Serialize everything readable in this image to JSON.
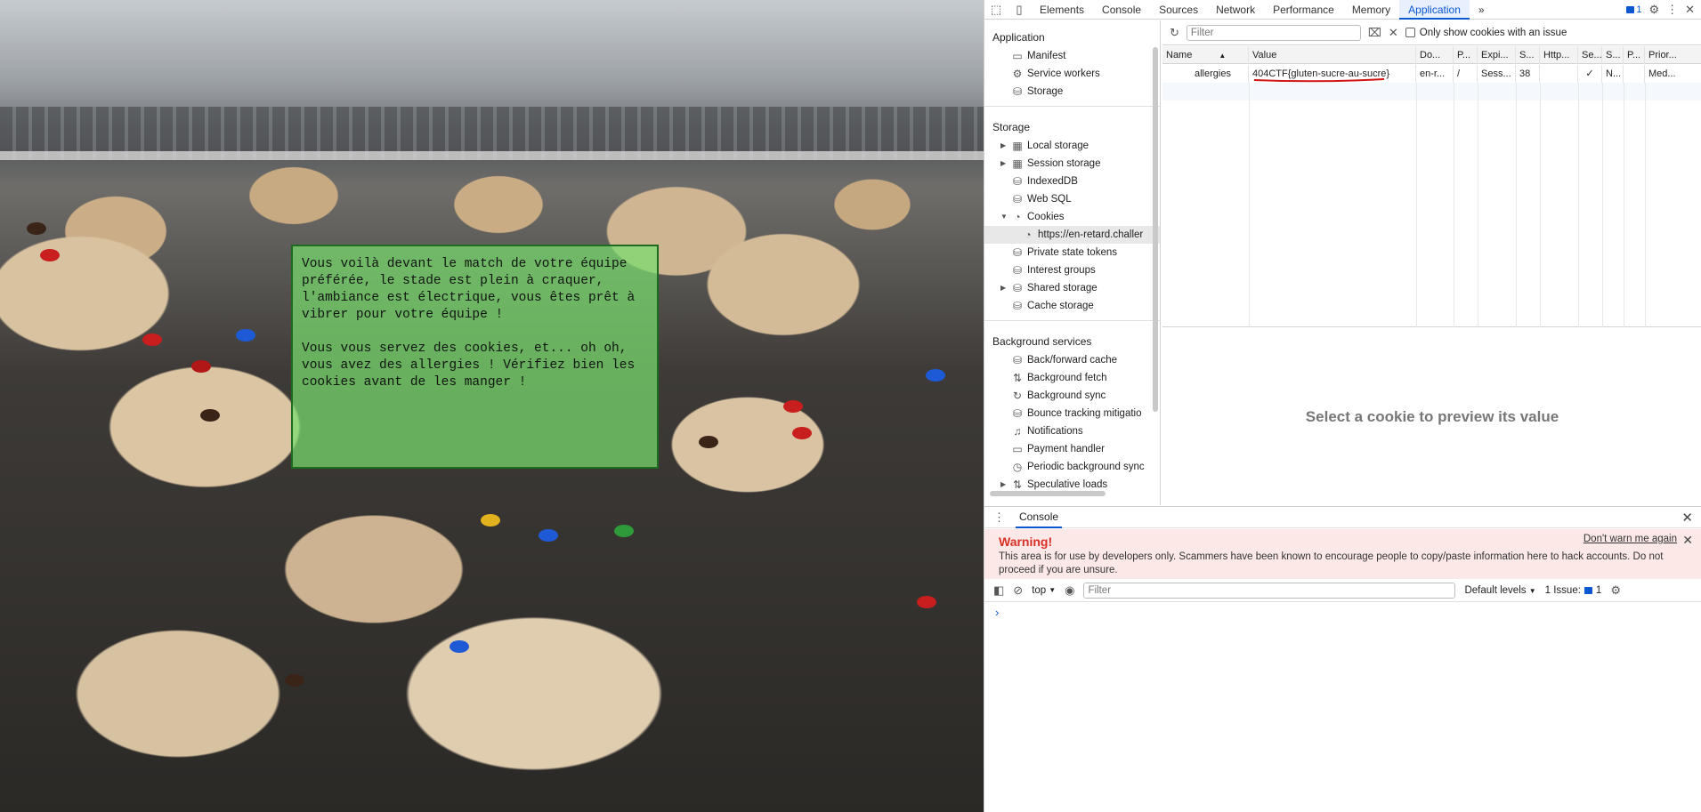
{
  "webpage": {
    "story": [
      "Vous voilà devant le match de votre équipe\npréférée, le stade est plein à craquer,\nl'ambiance est électrique, vous êtes prêt à\nvibrer pour votre équipe !",
      "Vous vous servez des cookies, et... oh oh,\nvous avez des allergies ! Vérifiez bien les\ncookies avant de les manger !"
    ]
  },
  "devtools": {
    "tabs": [
      "Elements",
      "Console",
      "Sources",
      "Network",
      "Performance",
      "Memory",
      "Application"
    ],
    "active_tab": "Application",
    "more_tabs": "»",
    "issues_count": "1",
    "sidebar": {
      "application_header": "Application",
      "application_items": [
        {
          "label": "Manifest",
          "icon": "document-icon"
        },
        {
          "label": "Service workers",
          "icon": "gear-icon"
        },
        {
          "label": "Storage",
          "icon": "database-icon"
        }
      ],
      "storage_header": "Storage",
      "storage_items": [
        {
          "label": "Local storage",
          "icon": "grid-icon"
        },
        {
          "label": "Session storage",
          "icon": "grid-icon"
        },
        {
          "label": "IndexedDB",
          "icon": "database-icon"
        },
        {
          "label": "Web SQL",
          "icon": "database-icon"
        },
        {
          "label": "Cookies",
          "icon": "cookie-icon"
        },
        {
          "label": "https://en-retard.challer",
          "icon": "cookie-icon"
        },
        {
          "label": "Private state tokens",
          "icon": "database-icon"
        },
        {
          "label": "Interest groups",
          "icon": "database-icon"
        },
        {
          "label": "Shared storage",
          "icon": "database-icon"
        },
        {
          "label": "Cache storage",
          "icon": "database-icon"
        }
      ],
      "background_header": "Background services",
      "background_items": [
        {
          "label": "Back/forward cache",
          "icon": "database-icon"
        },
        {
          "label": "Background fetch",
          "icon": "swap-icon"
        },
        {
          "label": "Background sync",
          "icon": "sync-icon"
        },
        {
          "label": "Bounce tracking mitigatio",
          "icon": "database-icon"
        },
        {
          "label": "Notifications",
          "icon": "bell-icon"
        },
        {
          "label": "Payment handler",
          "icon": "card-icon"
        },
        {
          "label": "Periodic background sync",
          "icon": "clock-icon"
        },
        {
          "label": "Speculative loads",
          "icon": "swap-icon"
        }
      ]
    },
    "toolbar": {
      "filter_placeholder": "Filter",
      "only_issues_label": "Only show cookies with an issue"
    },
    "cookie_table": {
      "headers": [
        "Name",
        "Value",
        "Do...",
        "P...",
        "Expi...",
        "S...",
        "Http...",
        "Se...",
        "S...",
        "P...",
        "Prior..."
      ],
      "rows": [
        [
          "allergies",
          "404CTF{gluten-sucre-au-sucre}",
          "en-r...",
          "/",
          "Sess...",
          "38",
          "",
          "✓",
          "N...",
          "",
          "Med..."
        ]
      ]
    },
    "preview_message": "Select a cookie to preview its value",
    "console": {
      "tab_label": "Console",
      "warning_title": "Warning!",
      "warning_text": "This area is for use by developers only. Scammers have been known to encourage people to copy/paste information here to hack accounts. Do not proceed if you are unsure.",
      "dont_warn": "Don't warn me again",
      "context": "top",
      "filter_placeholder": "Filter",
      "levels": "Default levels",
      "issues_label": "1 Issue:",
      "issues_count": "1",
      "prompt": "›"
    }
  }
}
